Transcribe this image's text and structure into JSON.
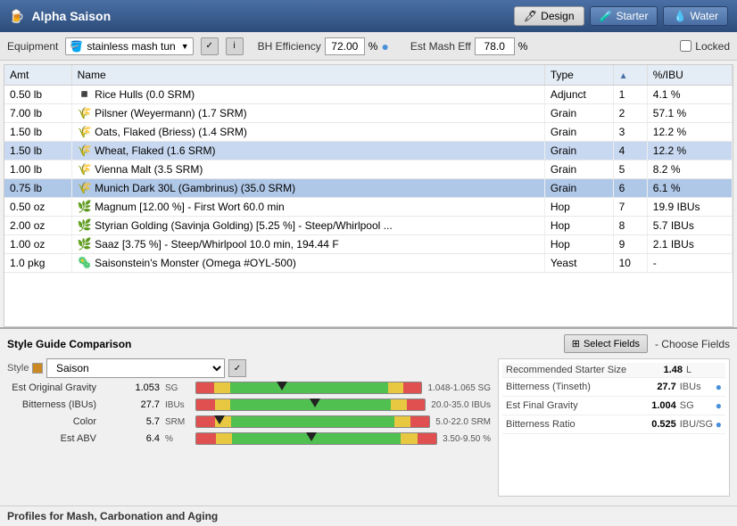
{
  "title": "Alpha Saison",
  "title_icon": "🍺",
  "tabs": [
    {
      "label": "Design",
      "active": true
    },
    {
      "label": "Starter",
      "active": false
    },
    {
      "label": "Water",
      "active": false
    }
  ],
  "equipment": {
    "label": "Equipment",
    "value": "stainless mash tun",
    "bh_efficiency_label": "BH Efficiency",
    "bh_efficiency_value": "72.00",
    "bh_efficiency_unit": "%",
    "est_mash_label": "Est Mash Eff",
    "est_mash_value": "78.0",
    "est_mash_unit": "%",
    "locked_label": "Locked"
  },
  "ingredients": {
    "columns": [
      "Amt",
      "Name",
      "Type",
      "",
      "%/IBU"
    ],
    "rows": [
      {
        "amt": "0.50 lb",
        "name": "Rice Hulls (0.0 SRM)",
        "type": "Adjunct",
        "order": "1",
        "pct": "4.1 %",
        "icon": "misc",
        "selected": false
      },
      {
        "amt": "7.00 lb",
        "name": "Pilsner (Weyermann) (1.7 SRM)",
        "type": "Grain",
        "order": "2",
        "pct": "57.1 %",
        "icon": "grain",
        "selected": false
      },
      {
        "amt": "1.50 lb",
        "name": "Oats, Flaked (Briess) (1.4 SRM)",
        "type": "Grain",
        "order": "3",
        "pct": "12.2 %",
        "icon": "grain",
        "selected": false
      },
      {
        "amt": "1.50 lb",
        "name": "Wheat, Flaked (1.6 SRM)",
        "type": "Grain",
        "order": "4",
        "pct": "12.2 %",
        "icon": "grain",
        "selected": true
      },
      {
        "amt": "1.00 lb",
        "name": "Vienna Malt (3.5 SRM)",
        "type": "Grain",
        "order": "5",
        "pct": "8.2 %",
        "icon": "grain",
        "selected": false
      },
      {
        "amt": "0.75 lb",
        "name": "Munich Dark 30L (Gambrinus) (35.0 SRM)",
        "type": "Grain",
        "order": "6",
        "pct": "6.1 %",
        "icon": "grain",
        "selected": true,
        "dark": true
      },
      {
        "amt": "0.50 oz",
        "name": "Magnum [12.00 %] - First Wort 60.0 min",
        "type": "Hop",
        "order": "7",
        "pct": "19.9 IBUs",
        "icon": "hop",
        "selected": false
      },
      {
        "amt": "2.00 oz",
        "name": "Styrian Golding (Savinja Golding) [5.25 %] - Steep/Whirlpool ...",
        "type": "Hop",
        "order": "8",
        "pct": "5.7 IBUs",
        "icon": "hop",
        "selected": false
      },
      {
        "amt": "1.00 oz",
        "name": "Saaz [3.75 %] - Steep/Whirlpool  10.0 min, 194.44 F",
        "type": "Hop",
        "order": "9",
        "pct": "2.1 IBUs",
        "icon": "hop",
        "selected": false
      },
      {
        "amt": "1.0 pkg",
        "name": "Saisonstein's Monster (Omega #OYL-500)",
        "type": "Yeast",
        "order": "10",
        "pct": "-",
        "icon": "yeast",
        "selected": false
      }
    ]
  },
  "style_comparison": {
    "section_title": "Style Guide Comparison",
    "style_label": "Style",
    "style_value": "Saison",
    "gauges": [
      {
        "name": "Est Original Gravity",
        "value": "1.053",
        "unit": "SG",
        "range": "1.048-1.065 SG",
        "marker_pct": 38
      },
      {
        "name": "Bitterness (IBUs)",
        "value": "27.7",
        "unit": "IBUs",
        "range": "20.0-35.0 IBUs",
        "marker_pct": 52
      },
      {
        "name": "Color",
        "value": "5.7",
        "unit": "SRM",
        "range": "5.0-22.0 SRM",
        "marker_pct": 10
      },
      {
        "name": "Est ABV",
        "value": "6.4",
        "unit": "%",
        "range": "3.50-9.50 %",
        "marker_pct": 48
      }
    ]
  },
  "select_fields_btn": "Select Fields",
  "choose_fields_label": "- Choose Fields",
  "right_stats": {
    "recommended_starter_label": "Recommended Starter Size",
    "recommended_starter_value": "1.48",
    "recommended_starter_unit": "L",
    "rows": [
      {
        "label": "Bitterness (Tinseth)",
        "value": "27.7",
        "unit": "IBUs"
      },
      {
        "label": "Est Final Gravity",
        "value": "1.004",
        "unit": "SG"
      },
      {
        "label": "Bitterness Ratio",
        "value": "0.525",
        "unit": "IBU/SG"
      }
    ]
  },
  "profiles_label": "Profiles for Mash, Carbonation and Aging"
}
